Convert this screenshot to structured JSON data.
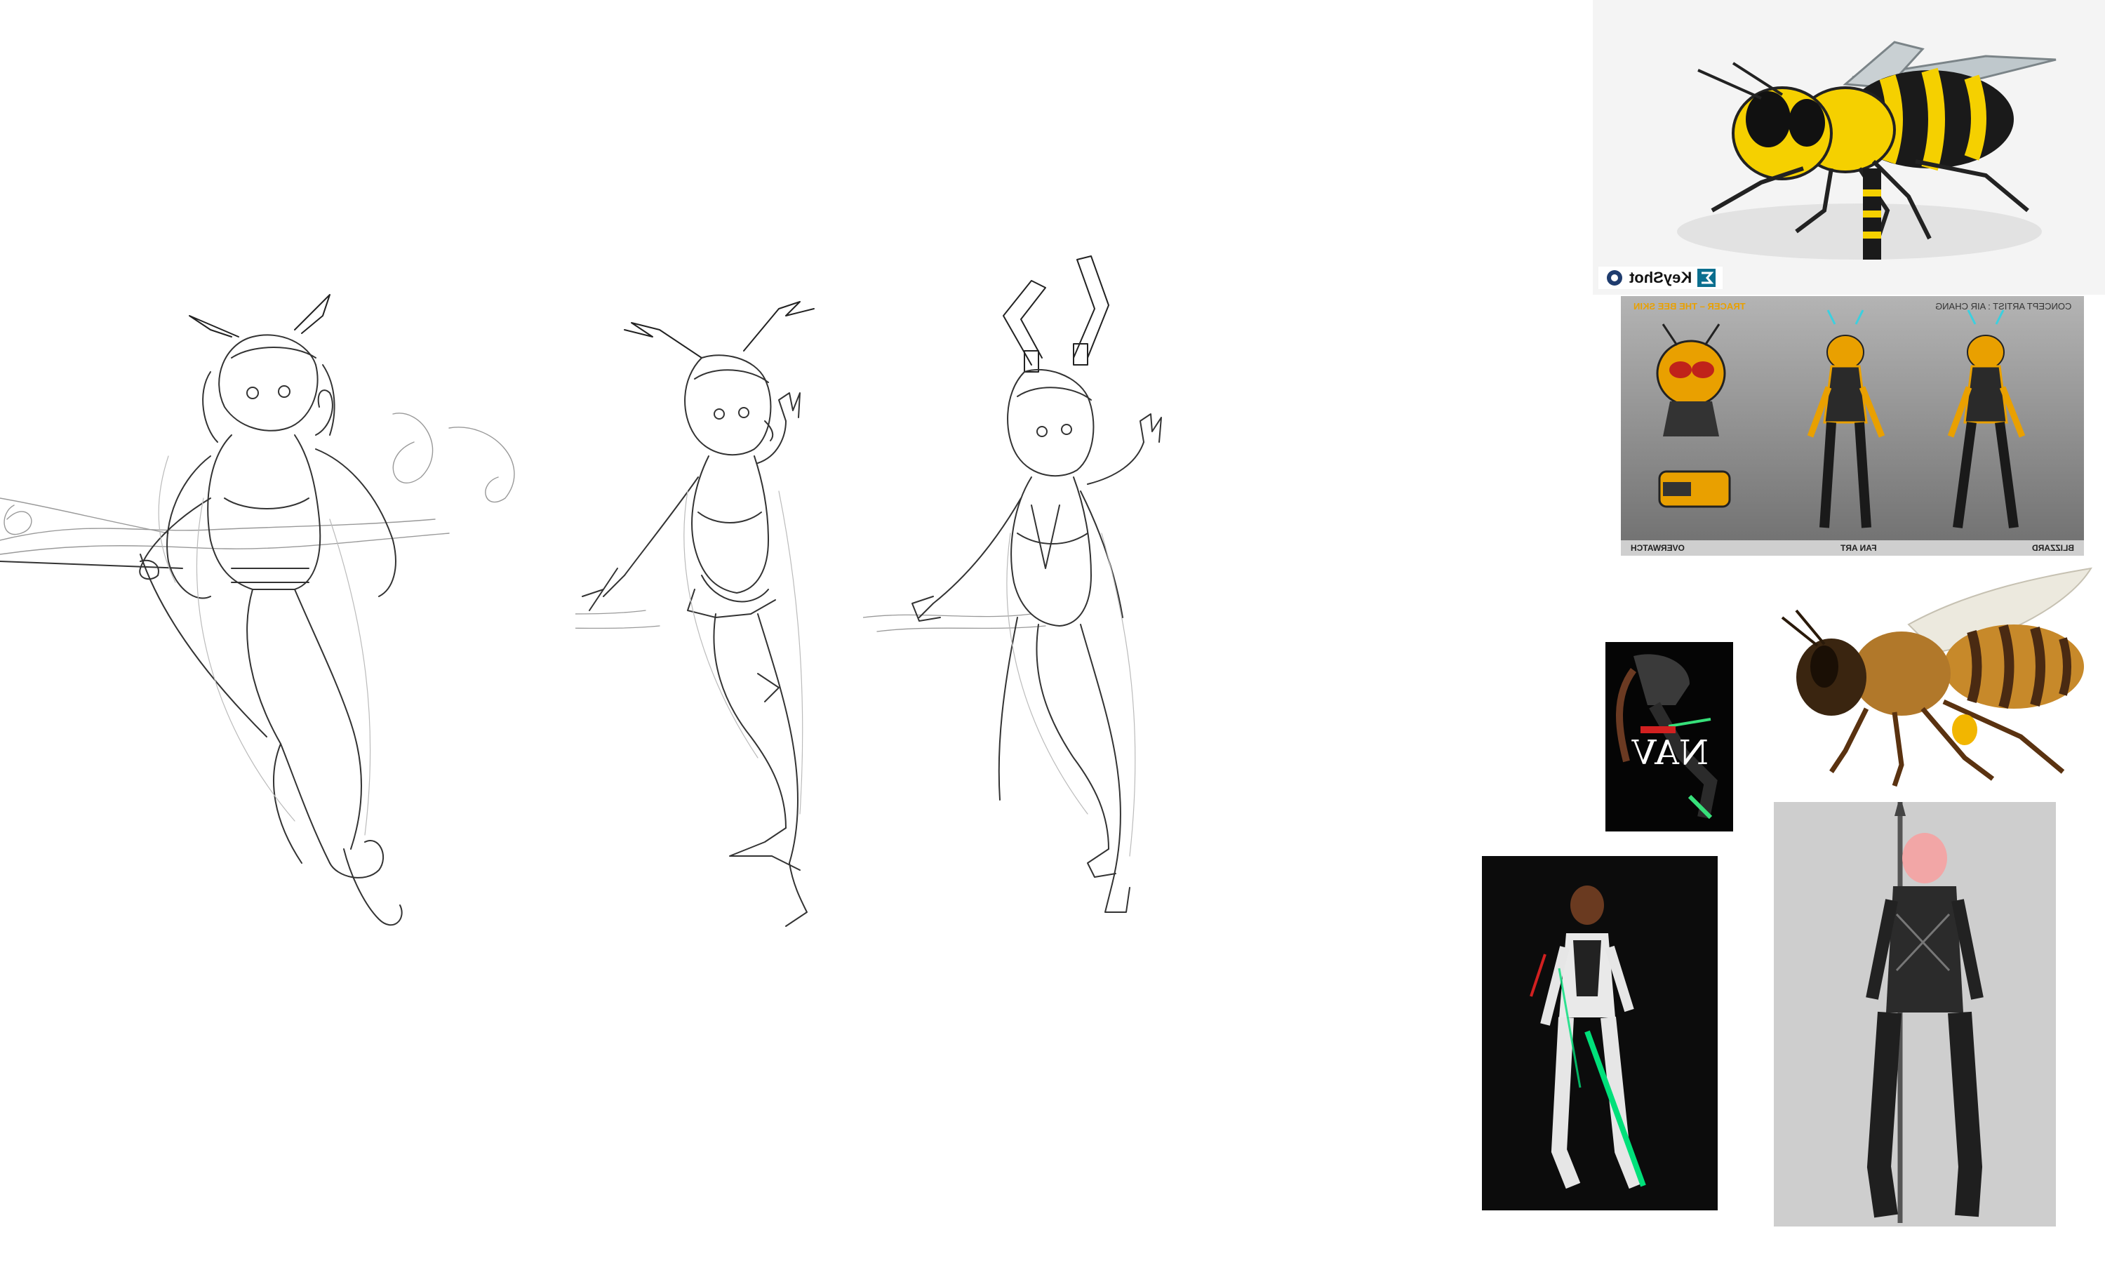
{
  "canvas": {
    "background": "#ffffff"
  },
  "sketches": [
    {
      "name": "sketch-bee-girl-v1"
    },
    {
      "name": "sketch-bee-girl-v2"
    },
    {
      "name": "sketch-bee-girl-v3"
    }
  ],
  "references": {
    "robot_bee": {
      "badge_text": "KeyShot",
      "accent": "#f5d000"
    },
    "concept_sheet": {
      "title": "TRACER – THE BEE SKIN",
      "artist_line": "CONCEPT ARTIST : AIR CHANG",
      "footer_left": "BLIZZARD",
      "footer_mid": "FAN ART",
      "footer_right": "OVERWATCH",
      "accent": "#e9a000"
    },
    "poster": {
      "text": "NAV"
    },
    "bee_photo": {
      "accent": "#d08a1e"
    },
    "cosplay_1": {
      "accent": "#00e07a"
    },
    "cosplay_2": {
      "accent": "#f2a6a6"
    }
  }
}
